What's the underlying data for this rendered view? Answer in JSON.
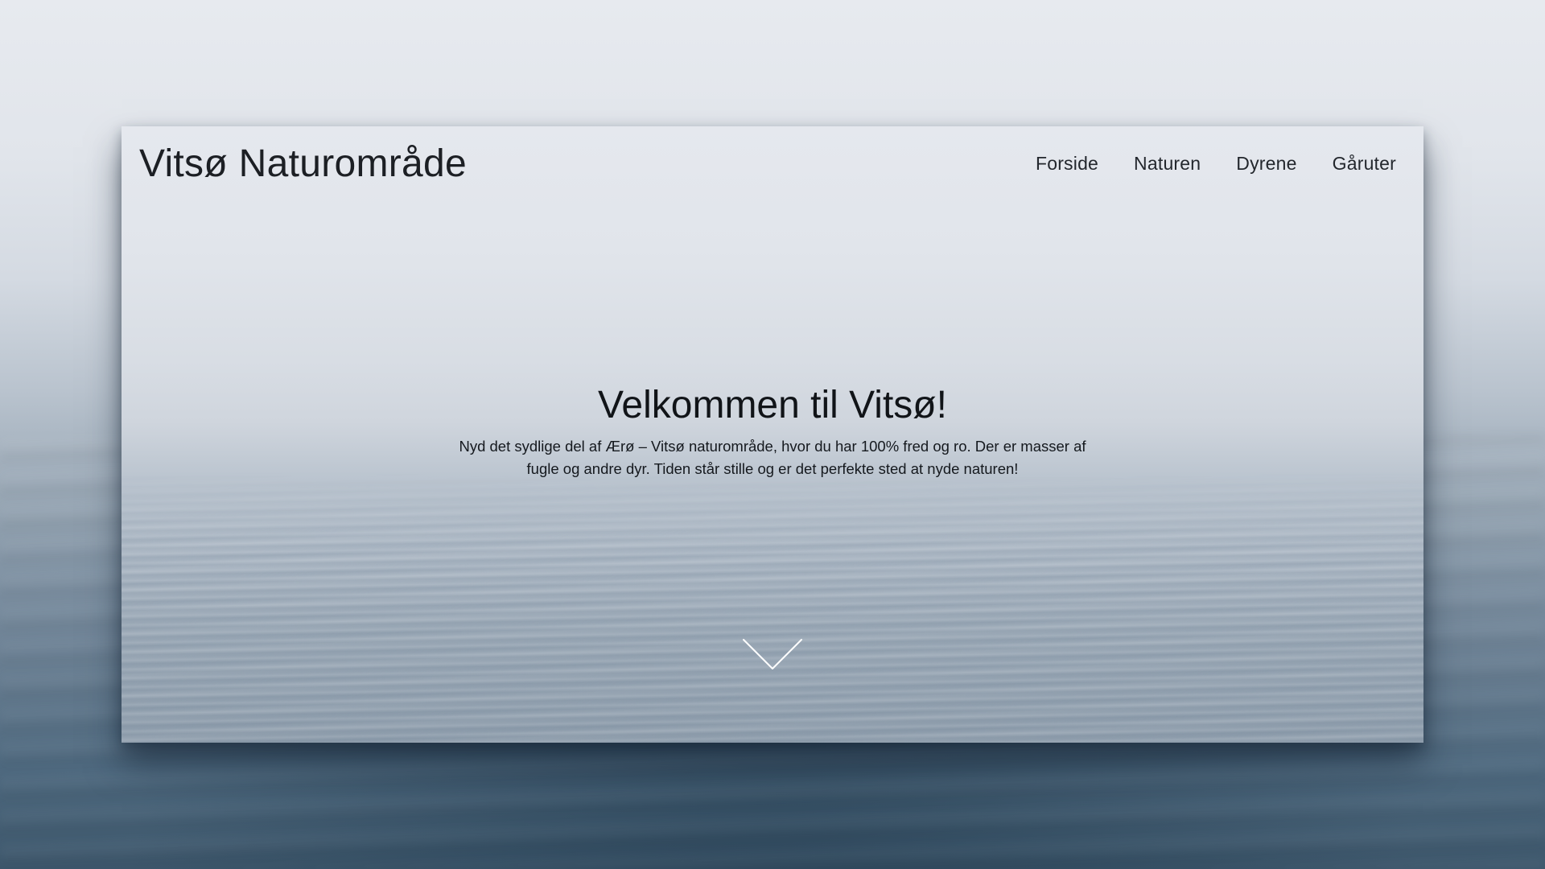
{
  "site": {
    "title": "Vitsø Naturområde"
  },
  "nav": {
    "items": [
      {
        "label": "Forside"
      },
      {
        "label": "Naturen"
      },
      {
        "label": "Dyrene"
      },
      {
        "label": "Gåruter"
      }
    ]
  },
  "hero": {
    "heading": "Velkommen til Vitsø!",
    "text": "Nyd det sydlige del af Ærø – Vitsø naturområde, hvor du har 100% fred og ro. Der er masser af fugle og andre dyr. Tiden står stille og er det perfekte sted at nyde naturen!"
  },
  "icons": {
    "scroll_down": "chevron-down-icon"
  },
  "colors": {
    "text_dark": "#1c1f24",
    "sky_light": "#e5e8ee",
    "water_blue": "#8e9dac"
  }
}
